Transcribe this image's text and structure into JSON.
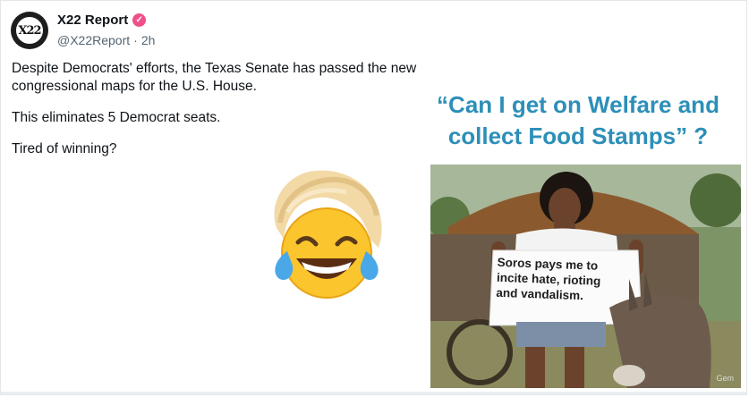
{
  "post": {
    "author": {
      "display_name": "X22 Report",
      "handle": "@X22Report",
      "avatar_text": "X22",
      "verified_icon": "verified-badge-icon",
      "badge_color": "#f0508a"
    },
    "separator": "·",
    "time": "2h",
    "text": [
      "Despite Democrats' efforts, the Texas Senate has passed the new congressional maps for the U.S. House.",
      "This eliminates 5 Democrat seats.",
      "Tired of winning?"
    ],
    "emoji_icon": "laughing-crying-emoji-with-blond-hair-icon"
  },
  "meme": {
    "caption": "“Can I get on Welfare and collect Food Stamps” ?",
    "caption_color": "#2d8fb8",
    "sign_text": "Soros pays me to incite hate, rioting and vandalism.",
    "watermark": "Gem"
  }
}
